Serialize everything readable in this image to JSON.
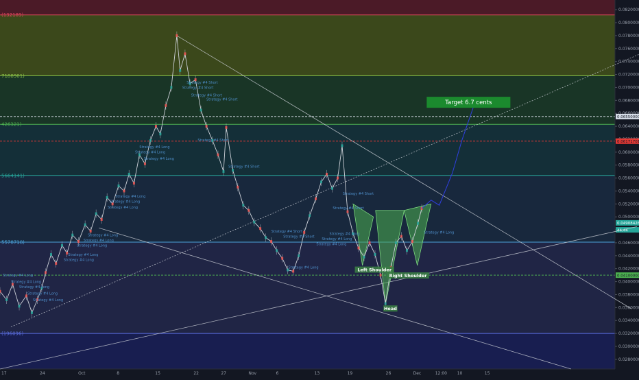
{
  "chart_data": {
    "type": "line",
    "instrument_note": "",
    "y_axis": {
      "ticks": [
        "0.08200000",
        "0.08000000",
        "0.07800000",
        "0.07600000",
        "0.07400000",
        "0.07200000",
        "0.07000000",
        "0.06800000",
        "0.06600000",
        "0.06400000",
        "0.06200000",
        "0.06000000",
        "0.05800000",
        "0.05600000",
        "0.05400000",
        "0.05200000",
        "0.05000000",
        "0.04800000",
        "0.04600000",
        "0.04400000",
        "0.04200000",
        "0.04000000",
        "0.03800000",
        "0.03600000",
        "0.03400000",
        "0.03200000",
        "0.03000000",
        "0.02800000"
      ],
      "ylim": [
        0.0265,
        0.0835
      ]
    },
    "x_axis": {
      "ticks": [
        {
          "label": "17",
          "day": 0
        },
        {
          "label": "24",
          "day": 7
        },
        {
          "label": "Oct",
          "day": 14
        },
        {
          "label": "8",
          "day": 21
        },
        {
          "label": "15",
          "day": 28
        },
        {
          "label": "22",
          "day": 35
        },
        {
          "label": "27",
          "day": 40
        },
        {
          "label": "Nov",
          "day": 45
        },
        {
          "label": "6",
          "day": 50
        },
        {
          "label": "13",
          "day": 57
        },
        {
          "label": "19",
          "day": 63
        },
        {
          "label": "26",
          "day": 70
        },
        {
          "label": "Dec",
          "day": 75
        },
        {
          "label": "12:00",
          "day": 79
        },
        {
          "label": "10",
          "day": 83
        },
        {
          "label": "15",
          "day": 88
        }
      ],
      "xlim": [
        0,
        112
      ]
    },
    "fib_levels": [
      {
        "label": "(132189)",
        "value": 0.0812,
        "color": "#e0475b",
        "fill": "#7a1e2c"
      },
      {
        "label": "7188901)",
        "value": 0.0718,
        "color": "#8bc34a",
        "fill": "#3d5d1e"
      },
      {
        "label": "426321)",
        "value": 0.0643,
        "color": "#4caf50",
        "fill": "#1e4a2a"
      },
      {
        "label": "5664141)",
        "value": 0.0564,
        "color": "#26a69a",
        "fill": "#163f47"
      },
      {
        "label": "5578718)",
        "value": 0.0461,
        "color": "#4ba3dc",
        "fill": "#1c3350"
      },
      {
        "label": "(196096)",
        "value": 0.032,
        "color": "#5b6ee1",
        "fill": "#2a2f5e"
      }
    ],
    "horizontal_lines": [
      {
        "value": 0.0655,
        "color": "#d6dde8",
        "dashed": true,
        "price_label": "0.06550000"
      },
      {
        "value": 0.0617,
        "color": "#e53935",
        "dashed": true,
        "price_label": "0.06171701"
      },
      {
        "value": 0.041,
        "color": "#4caf50",
        "dashed": true,
        "price_label": "0.04100000"
      }
    ],
    "price_labels": [
      {
        "text": "0.04908428",
        "value": 0.04908,
        "color": "#26a69a"
      },
      {
        "text": "44:44",
        "value": 0.048,
        "color": "#26a69a"
      }
    ],
    "series": [
      {
        "color": "#cfd3da",
        "points": [
          [
            0,
            0.0385
          ],
          [
            1.2,
            0.0372
          ],
          [
            2.3,
            0.0396
          ],
          [
            3.5,
            0.0362
          ],
          [
            4.8,
            0.0378
          ],
          [
            5.8,
            0.0352
          ],
          [
            6.8,
            0.0372
          ],
          [
            7.6,
            0.039
          ],
          [
            8.3,
            0.0414
          ],
          [
            9.3,
            0.0442
          ],
          [
            10.2,
            0.0428
          ],
          [
            11.3,
            0.0456
          ],
          [
            12.2,
            0.0444
          ],
          [
            13.2,
            0.0472
          ],
          [
            14.3,
            0.0462
          ],
          [
            15.5,
            0.0488
          ],
          [
            16.5,
            0.0478
          ],
          [
            17.5,
            0.0505
          ],
          [
            18.5,
            0.0496
          ],
          [
            19.5,
            0.053
          ],
          [
            20.5,
            0.052
          ],
          [
            21.6,
            0.0548
          ],
          [
            22.6,
            0.054
          ],
          [
            23.5,
            0.0566
          ],
          [
            24.4,
            0.0552
          ],
          [
            25.4,
            0.0596
          ],
          [
            26.4,
            0.0582
          ],
          [
            27.4,
            0.0618
          ],
          [
            28.4,
            0.064
          ],
          [
            29.2,
            0.0628
          ],
          [
            30.2,
            0.0672
          ],
          [
            31.2,
            0.07
          ],
          [
            32.2,
            0.078
          ],
          [
            32.8,
            0.0726
          ],
          [
            33.7,
            0.0752
          ],
          [
            34.6,
            0.0706
          ],
          [
            35.6,
            0.0712
          ],
          [
            36.6,
            0.0665
          ],
          [
            37.6,
            0.064
          ],
          [
            38.7,
            0.0618
          ],
          [
            39.7,
            0.0596
          ],
          [
            40.7,
            0.057
          ],
          [
            41.2,
            0.0638
          ],
          [
            42.4,
            0.0572
          ],
          [
            43.3,
            0.0546
          ],
          [
            44.3,
            0.0518
          ],
          [
            45.3,
            0.051
          ],
          [
            46.3,
            0.0492
          ],
          [
            47.4,
            0.0482
          ],
          [
            48.4,
            0.0468
          ],
          [
            49.4,
            0.0462
          ],
          [
            50.4,
            0.0448
          ],
          [
            51.4,
            0.0436
          ],
          [
            52.4,
            0.0418
          ],
          [
            53.4,
            0.0416
          ],
          [
            54.4,
            0.044
          ],
          [
            55.4,
            0.0476
          ],
          [
            56.4,
            0.0502
          ],
          [
            57.5,
            0.0528
          ],
          [
            58.5,
            0.0554
          ],
          [
            59.5,
            0.0566
          ],
          [
            60.5,
            0.0544
          ],
          [
            61.5,
            0.056
          ],
          [
            62.3,
            0.061
          ],
          [
            63.3,
            0.0508
          ],
          [
            64.3,
            0.0474
          ],
          [
            65.3,
            0.0452
          ],
          [
            66.3,
            0.0438
          ],
          [
            67.3,
            0.046
          ],
          [
            68.3,
            0.0442
          ],
          [
            69.3,
            0.041
          ],
          [
            70.2,
            0.0366
          ],
          [
            71.2,
            0.0422
          ],
          [
            72.1,
            0.046
          ],
          [
            73.1,
            0.047
          ],
          [
            74.1,
            0.0448
          ],
          [
            75.1,
            0.0462
          ],
          [
            76.1,
            0.049
          ],
          [
            76.8,
            0.0513
          ]
        ]
      }
    ],
    "trend_lines": [
      {
        "from": [
          32.2,
          0.078
        ],
        "to": [
          115.0,
          0.0358
        ],
        "color": "#cfd3da",
        "dashed": false
      },
      {
        "from": [
          2,
          0.033
        ],
        "to": [
          118,
          0.0757
        ],
        "color": "#cfd3da",
        "dashed": true
      },
      {
        "from": [
          0,
          0.0265
        ],
        "to": [
          116,
          0.0485
        ],
        "color": "#cfd3da",
        "dashed": false
      },
      {
        "from": [
          18,
          0.0483
        ],
        "to": [
          104,
          0.0265
        ],
        "color": "#cfd3da",
        "dashed": false
      }
    ],
    "projection": {
      "points": [
        [
          76.8,
          0.0513
        ],
        [
          78.5,
          0.0526
        ],
        [
          80.0,
          0.0518
        ],
        [
          82.4,
          0.0568
        ],
        [
          84.1,
          0.0618
        ],
        [
          86.3,
          0.0672
        ]
      ],
      "color": "#2f3fe0"
    },
    "patterns": [
      {
        "name": "Left Shoulder",
        "points": [
          [
            64.3,
            0.052
          ],
          [
            68.0,
            0.05
          ],
          [
            66.0,
            0.0425
          ]
        ],
        "color": "#4caf50"
      },
      {
        "name": "Head",
        "points": [
          [
            70.2,
            0.0365
          ],
          [
            68.4,
            0.051
          ],
          [
            73.6,
            0.051
          ]
        ],
        "color": "#4caf50"
      },
      {
        "name": "Right Shoulder",
        "points": [
          [
            73.6,
            0.051
          ],
          [
            78.5,
            0.052
          ],
          [
            76.0,
            0.0425
          ]
        ],
        "color": "#4caf50"
      }
    ],
    "annotations": [
      {
        "text": "Left Shoulder",
        "day": 68.2,
        "value": 0.0418
      },
      {
        "text": "Head",
        "day": 71.1,
        "value": 0.0358
      },
      {
        "text": "Right Shoulder",
        "day": 74.3,
        "value": 0.0409
      },
      {
        "text": "Target 6.7 cents",
        "day": 85.2,
        "value": 0.0677
      }
    ],
    "strategy_labels": [
      {
        "text": "Strategy #4 Short",
        "day": 34.0,
        "value": 0.0706
      },
      {
        "text": "Strategy #4 Short",
        "day": 33.2,
        "value": 0.0698
      },
      {
        "text": "Strategy #4 Short",
        "day": 34.8,
        "value": 0.0686
      },
      {
        "text": "Strategy #4 Short",
        "day": 37.6,
        "value": 0.068
      },
      {
        "text": "Strategy #4 Short",
        "day": 36.0,
        "value": 0.0617
      },
      {
        "text": "Strategy #4 Long",
        "day": 25.4,
        "value": 0.0606
      },
      {
        "text": "Strategy #4 Long",
        "day": 24.6,
        "value": 0.0598
      },
      {
        "text": "Strategy #4 Long",
        "day": 26.2,
        "value": 0.0588
      },
      {
        "text": "Strategy #4 Short",
        "day": 41.6,
        "value": 0.0576
      },
      {
        "text": "Strategy #4 Long",
        "day": 21.0,
        "value": 0.053
      },
      {
        "text": "Strategy #4 Long",
        "day": 20.0,
        "value": 0.0522
      },
      {
        "text": "Strategy #4 Long",
        "day": 19.6,
        "value": 0.0513
      },
      {
        "text": "Strategy #4 Long",
        "day": 16.0,
        "value": 0.047
      },
      {
        "text": "Strategy #4 Long",
        "day": 15.2,
        "value": 0.0462
      },
      {
        "text": "Strategy #4 Long",
        "day": 14.0,
        "value": 0.0454
      },
      {
        "text": "Strategy #4 Long",
        "day": 12.4,
        "value": 0.044
      },
      {
        "text": "Strategy #4 Long",
        "day": 11.6,
        "value": 0.0432
      },
      {
        "text": "Strategy #4 Short",
        "day": 49.4,
        "value": 0.0476
      },
      {
        "text": "Strategy #4 Short",
        "day": 51.6,
        "value": 0.0468
      },
      {
        "text": "Strategy #4 Short",
        "day": 60.6,
        "value": 0.0512
      },
      {
        "text": "Strategy #4 Short",
        "day": 62.4,
        "value": 0.0534
      },
      {
        "text": "Strategy #4 Long",
        "day": 60.0,
        "value": 0.0472
      },
      {
        "text": "Strategy #4 Long",
        "day": 58.6,
        "value": 0.0464
      },
      {
        "text": "Strategy #4 Long",
        "day": 57.6,
        "value": 0.0456
      },
      {
        "text": "Strategy #4 Long",
        "day": 52.5,
        "value": 0.042
      },
      {
        "text": "Strategy #4 Long",
        "day": 0.5,
        "value": 0.0408
      },
      {
        "text": "Strategy #4 Long",
        "day": 2.0,
        "value": 0.0398
      },
      {
        "text": "Strategy #4 Long",
        "day": 3.5,
        "value": 0.039
      },
      {
        "text": "Strategy #4 Long",
        "day": 5.0,
        "value": 0.038
      },
      {
        "text": "Strategy #4 Long",
        "day": 6.0,
        "value": 0.037
      },
      {
        "text": "Strategy #4 Long",
        "day": 77.2,
        "value": 0.0474
      }
    ]
  }
}
